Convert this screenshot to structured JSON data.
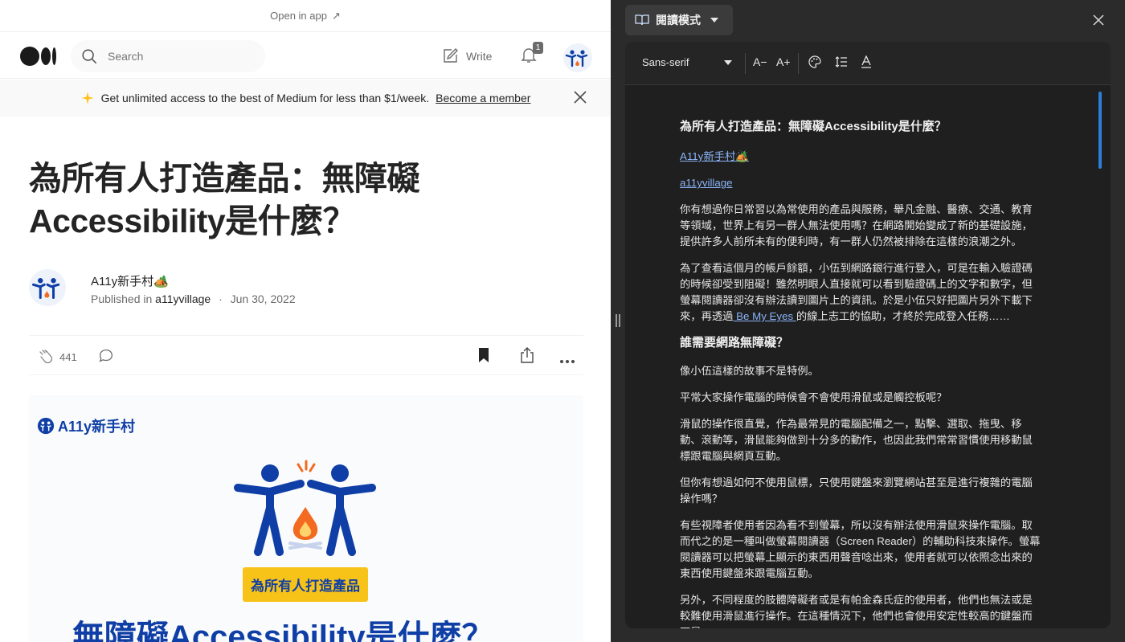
{
  "medium": {
    "open_in_app": "Open in app",
    "search_placeholder": "Search",
    "write_label": "Write",
    "notification_count": "1",
    "banner": {
      "text": "Get unlimited access to the best of Medium for less than $1/week.",
      "link": "Become a member"
    },
    "article": {
      "title_line1": "為所有人打造產品：無障礙",
      "title_line2": "Accessibility是什麼？",
      "author": "A11y新手村🏕️",
      "published_prefix": "Published in",
      "publication": "a11yvillage",
      "separator": "·",
      "date": "Jun 30, 2022",
      "claps": "441"
    },
    "hero": {
      "logo_text": "A11y新手村",
      "tag": "為所有人打造產品",
      "big_text": "無障礙Accessibility是什麼？"
    }
  },
  "reading_mode": {
    "header_label": "閱讀模式",
    "font_name": "Sans-serif",
    "toolbar": {
      "decrease": "A−",
      "increase": "A+"
    },
    "content": {
      "title": "為所有人打造產品：無障礙Accessibility是什麼？",
      "author_link": "A11y新手村🏕️",
      "pub_link": "a11yvillage",
      "p1": "你有想過你日常習以為常使用的產品與服務，舉凡金融、醫療、交通、教育等領域，世界上有另一群人無法使用嗎？在網路開始變成了新的基礎設施，提供許多人前所未有的便利時，有一群人仍然被排除在這樣的浪潮之外。",
      "p2_a": "為了查看這個月的帳戶餘額，小伍到網路銀行進行登入，可是在輸入驗證碼的時候卻受到阻礙！雖然明眼人直接就可以看到驗證碼上的文字和數字，但螢幕閱讀器卻沒有辦法讀到圖片上的資訊。於是小伍只好把圖片另外下載下來，再透過",
      "p2_link": " Be My Eyes ",
      "p2_b": "的線上志工的協助，才終於完成登入任務……",
      "h2": "誰需要網路無障礙？",
      "p3": "像小伍這樣的故事不是特例。",
      "p4": "平常大家操作電腦的時候會不會使用滑鼠或是觸控板呢？",
      "p5": "滑鼠的操作很直覺，作為最常見的電腦配備之一，點擊、選取、拖曳、移動、滾動等，滑鼠能夠做到十分多的動作，也因此我們常常習慣使用移動鼠標跟電腦與網頁互動。",
      "p6": "但你有想過如何不使用鼠標，只使用鍵盤來瀏覽網站甚至是進行複雜的電腦操作嗎？",
      "p7": "有些視障者使用者因為看不到螢幕，所以沒有辦法使用滑鼠來操作電腦。取而代之的是一種叫做螢幕閱讀器（Screen Reader）的輔助科技來操作。螢幕閱讀器可以把螢幕上顯示的東西用聲音唸出來，使用者就可以依照念出來的東西使用鍵盤來跟電腦互動。",
      "p8": "另外，不同程度的肢體障礙者或是有帕金森氏症的使用者，他們也無法或是較難使用滑鼠進行操作。在這種情況下，他們也會使用安定性較高的鍵盤而不是"
    }
  },
  "colors": {
    "brand_blue": "#0f3fa6",
    "flame_orange": "#f36b21",
    "tag_yellow": "#f7c318",
    "link_blue": "#8ab4f8"
  }
}
